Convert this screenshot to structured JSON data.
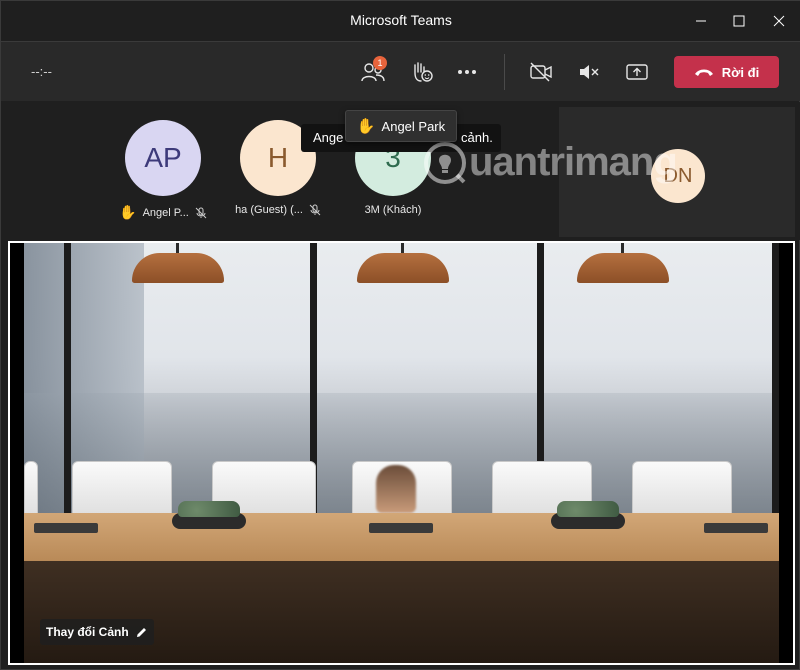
{
  "window": {
    "title": "Microsoft Teams"
  },
  "toolbar": {
    "timer": "--:--",
    "participants_badge": "1",
    "leave_label": "Rời đi",
    "icons": [
      "people-icon",
      "raise-hand-icon",
      "more-icon",
      "camera-off-icon",
      "mic-muted-icon",
      "share-screen-icon",
      "phone-hangup-icon"
    ]
  },
  "colors": {
    "leave_button": "#c4314b",
    "badge": "#e8643c",
    "background": "#1f1f1f"
  },
  "participants": [
    {
      "initials": "AP",
      "name": "Angel P...",
      "hand_raised": true,
      "muted": true,
      "avatar_bg": "#d9d6f2",
      "avatar_fg": "#3d3a7a"
    },
    {
      "initials": "H",
      "name": "ha (Guest) (...",
      "hand_raised": false,
      "muted": true,
      "avatar_bg": "#fbe6cf",
      "avatar_fg": "#8a5a2e"
    },
    {
      "initials": "3",
      "name": "3M (Khách)",
      "hand_raised": false,
      "muted": false,
      "avatar_bg": "#d3ecdf",
      "avatar_fg": "#2f6b4f"
    }
  ],
  "self_view": {
    "initials": "DN"
  },
  "tooltip": {
    "text": "Angel Park",
    "behind_left": "Ange",
    "behind_right": "cảnh."
  },
  "watermark": {
    "text": "uantrimang"
  },
  "stage": {
    "change_scene_label": "Thay đổi Cảnh"
  }
}
